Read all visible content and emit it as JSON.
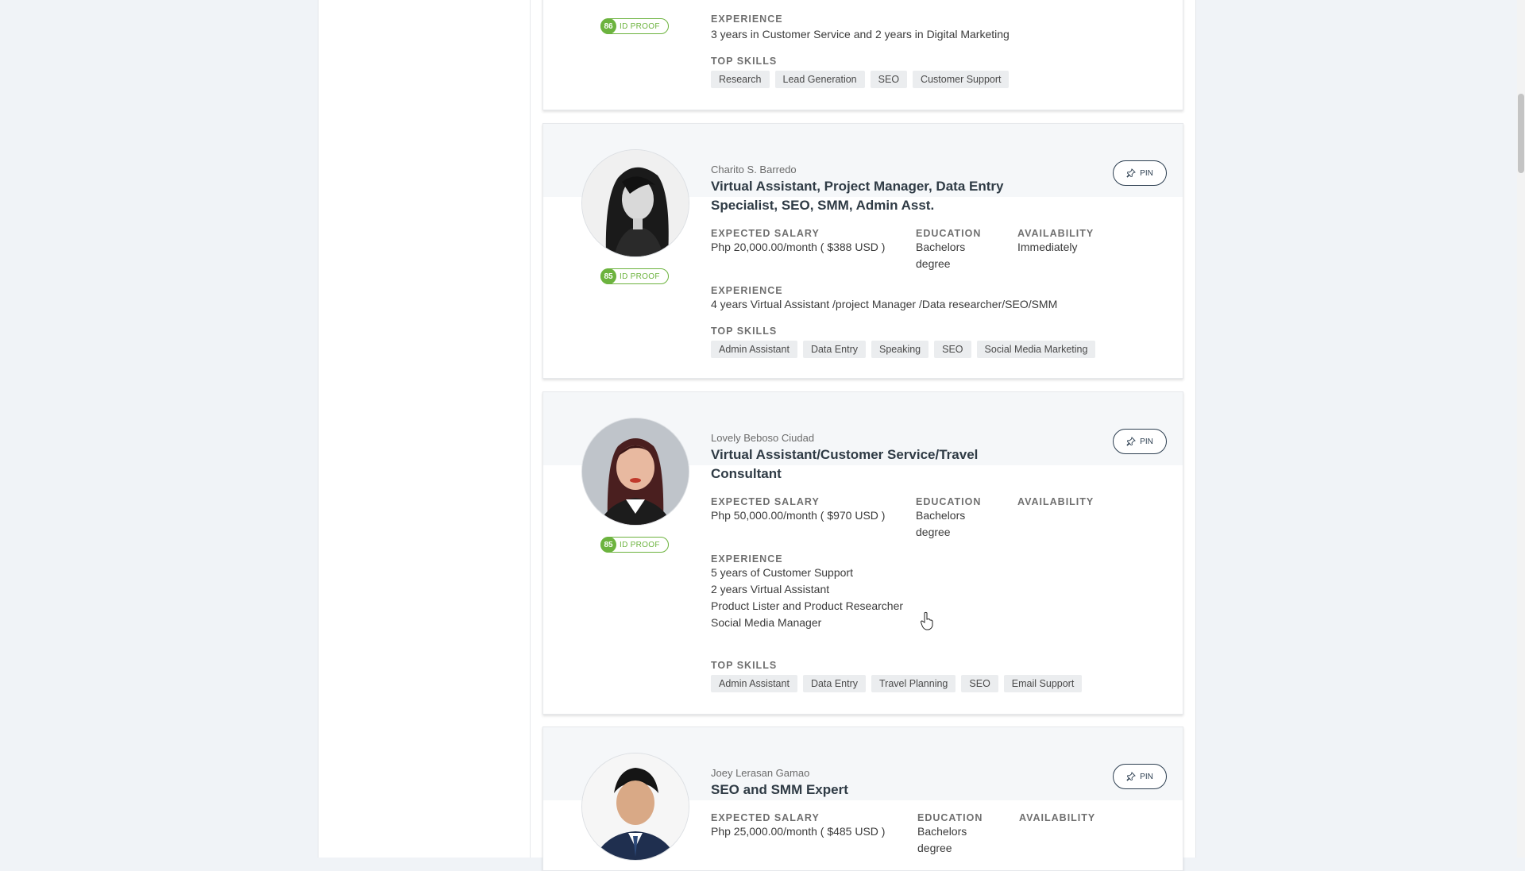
{
  "labels": {
    "expected_salary": "EXPECTED SALARY",
    "education": "EDUCATION",
    "availability": "AVAILABILITY",
    "experience": "EXPERIENCE",
    "top_skills": "TOP SKILLS",
    "id_proof": "ID PROOF",
    "pin": "PIN"
  },
  "cards": [
    {
      "score": "86",
      "experience": "3 years in Customer Service and 2 years in Digital Marketing",
      "skills": [
        "Research",
        "Lead Generation",
        "SEO",
        "Customer Support"
      ]
    },
    {
      "name": "Charito S. Barredo",
      "title": "Virtual Assistant, Project Manager, Data Entry Specialist, SEO, SMM, Admin Asst.",
      "salary": "Php 20,000.00/month ( $388 USD )",
      "education": "Bachelors degree",
      "availability": "Immediately",
      "score": "85",
      "experience": [
        "4 years Virtual Assistant /project Manager /Data researcher/SEO/SMM"
      ],
      "skills": [
        "Admin Assistant",
        "Data Entry",
        "Speaking",
        "SEO",
        "Social Media Marketing"
      ]
    },
    {
      "name": "Lovely Beboso Ciudad",
      "title": "Virtual Assistant/Customer Service/Travel Consultant",
      "salary": "Php 50,000.00/month ( $970 USD )",
      "education": "Bachelors degree",
      "availability": "",
      "score": "85",
      "experience": [
        "5 years of Customer Support",
        "2 years Virtual Assistant",
        "Product Lister and Product Researcher",
        "Social Media Manager"
      ],
      "skills": [
        "Admin Assistant",
        "Data Entry",
        "Travel Planning",
        "SEO",
        "Email Support"
      ]
    },
    {
      "name": "Joey Lerasan Gamao",
      "title": "SEO and SMM Expert",
      "salary": "Php 25,000.00/month ( $485 USD )",
      "education": "Bachelors degree",
      "availability": ""
    }
  ]
}
